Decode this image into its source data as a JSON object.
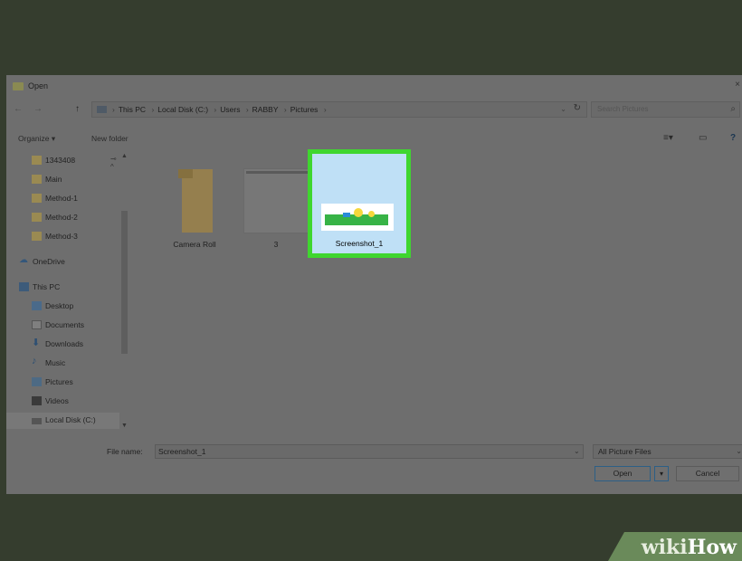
{
  "window": {
    "title": "Open",
    "close_label": "×"
  },
  "navigation": {
    "back": "←",
    "forward": "→",
    "up": "↑",
    "breadcrumbs": [
      "This PC",
      "Local Disk (C:)",
      "Users",
      "RABBY",
      "Pictures"
    ],
    "search_placeholder": "Search Pictures"
  },
  "toolbar": {
    "organize_label": "Organize ▾",
    "new_folder_label": "New folder"
  },
  "sidebar": {
    "items": [
      {
        "label": "1343408",
        "icon": "folder-icon"
      },
      {
        "label": "Main",
        "icon": "folder-icon"
      },
      {
        "label": "Method-1",
        "icon": "folder-icon"
      },
      {
        "label": "Method-2",
        "icon": "folder-icon"
      },
      {
        "label": "Method-3",
        "icon": "folder-icon"
      },
      {
        "label": "OneDrive",
        "icon": "cloud-icon"
      },
      {
        "label": "This PC",
        "icon": "monitor-icon"
      },
      {
        "label": "Desktop",
        "icon": "desktop-icon"
      },
      {
        "label": "Documents",
        "icon": "documents-icon"
      },
      {
        "label": "Downloads",
        "icon": "download-icon"
      },
      {
        "label": "Music",
        "icon": "music-icon"
      },
      {
        "label": "Pictures",
        "icon": "pictures-icon"
      },
      {
        "label": "Videos",
        "icon": "video-icon"
      },
      {
        "label": "Local Disk (C:)",
        "icon": "disk-icon"
      }
    ],
    "selected": "Local Disk (C:)"
  },
  "files": [
    {
      "name": "Camera Roll",
      "type": "folder"
    },
    {
      "name": "3",
      "type": "image"
    },
    {
      "name": "Screenshot_1",
      "type": "image",
      "selected": true
    }
  ],
  "footer": {
    "file_name_label": "File name:",
    "file_name_value": "Screenshot_1",
    "filter_value": "All Picture Files",
    "open_label": "Open",
    "cancel_label": "Cancel"
  },
  "watermark": {
    "wiki": "wiki",
    "how": "How"
  },
  "colors": {
    "highlight": "#3fd62f",
    "selection_bg": "#bfe0f6",
    "backdrop": "#353d2e"
  }
}
